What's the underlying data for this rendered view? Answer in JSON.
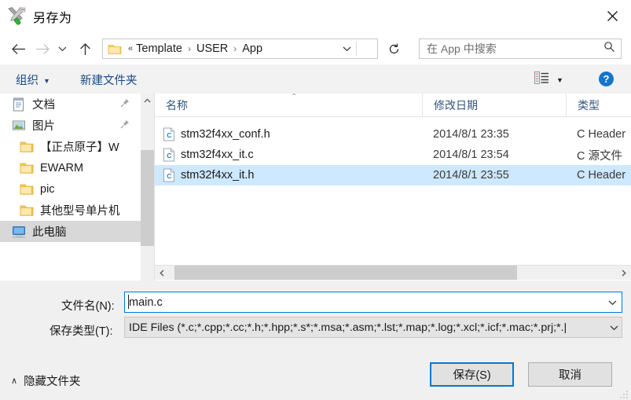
{
  "window": {
    "title": "另存为",
    "icon": "ewarm-app-icon",
    "close_label": "✕"
  },
  "nav": {
    "back_icon": "arrow-left-icon",
    "forward_icon": "arrow-right-icon",
    "recent_icon": "chevron-down-icon",
    "up_icon": "arrow-up-icon",
    "refresh_icon": "refresh-icon",
    "address": {
      "folder_icon": "folder-icon",
      "prefix": "«",
      "crumbs": [
        "Template",
        "USER",
        "App"
      ],
      "separator": "›",
      "dropdown_icon": "chevron-down-icon"
    },
    "search": {
      "placeholder": "在 App 中搜索",
      "icon": "search-icon"
    }
  },
  "toolbar": {
    "organize_label": "组织",
    "organize_caret": "▼",
    "new_folder_label": "新建文件夹",
    "view_icon": "view-list-icon",
    "view_caret": "▼",
    "help_label": "?"
  },
  "sidebar": {
    "items": [
      {
        "label": "文档",
        "icon": "document-icon",
        "pinned": true,
        "selected": false,
        "indent": false
      },
      {
        "label": "图片",
        "icon": "pictures-icon",
        "pinned": true,
        "selected": false,
        "indent": false
      },
      {
        "label": "【正点原子】W",
        "icon": "folder-icon",
        "pinned": false,
        "selected": false,
        "indent": true
      },
      {
        "label": "EWARM",
        "icon": "folder-icon",
        "pinned": false,
        "selected": false,
        "indent": true
      },
      {
        "label": "pic",
        "icon": "folder-icon",
        "pinned": false,
        "selected": false,
        "indent": true
      },
      {
        "label": "其他型号单片机",
        "icon": "folder-icon",
        "pinned": false,
        "selected": false,
        "indent": true
      },
      {
        "label": "此电脑",
        "icon": "this-pc-icon",
        "pinned": false,
        "selected": true,
        "indent": false
      }
    ],
    "scroll_up_icon": "chevron-up-icon",
    "scroll_down_icon": "chevron-down-icon"
  },
  "filelist": {
    "columns": [
      {
        "label": "名称",
        "key": "name"
      },
      {
        "label": "修改日期",
        "key": "date"
      },
      {
        "label": "类型",
        "key": "type"
      }
    ],
    "sort_caret": "⌃",
    "rows": [
      {
        "name": "stm32f4xx_conf.h",
        "date": "2014/8/1 23:35",
        "type": "C Header",
        "icon": "c-file-icon",
        "selected": false
      },
      {
        "name": "stm32f4xx_it.c",
        "date": "2014/8/1 23:54",
        "type": "C 源文件",
        "icon": "c-file-icon",
        "selected": false
      },
      {
        "name": "stm32f4xx_it.h",
        "date": "2014/8/1 23:55",
        "type": "C Header",
        "icon": "c-file-icon",
        "selected": true
      }
    ],
    "hscroll_left_icon": "chevron-left-icon",
    "hscroll_right_icon": "chevron-right-icon"
  },
  "form": {
    "filename_label": "文件名(N):",
    "filename_value": "main.c",
    "filename_dropdown_icon": "chevron-down-icon",
    "filetype_label": "保存类型(T):",
    "filetype_value": "IDE Files (*.c;*.cpp;*.cc;*.h;*.hpp;*.s*;*.msa;*.asm;*.lst;*.map;*.log;*.xcl;*.icf;*.mac;*.prj;*.|",
    "filetype_dropdown_icon": "chevron-down-icon"
  },
  "footer": {
    "hide_folders_chevron": "∧",
    "hide_folders_label": "隐藏文件夹",
    "save_label": "保存(S)",
    "cancel_label": "取消"
  },
  "colors": {
    "accent": "#0078d7",
    "selection": "#cde8ff",
    "toolbar_link": "#1b4b82",
    "chrome_bg": "#f0f0f0"
  }
}
